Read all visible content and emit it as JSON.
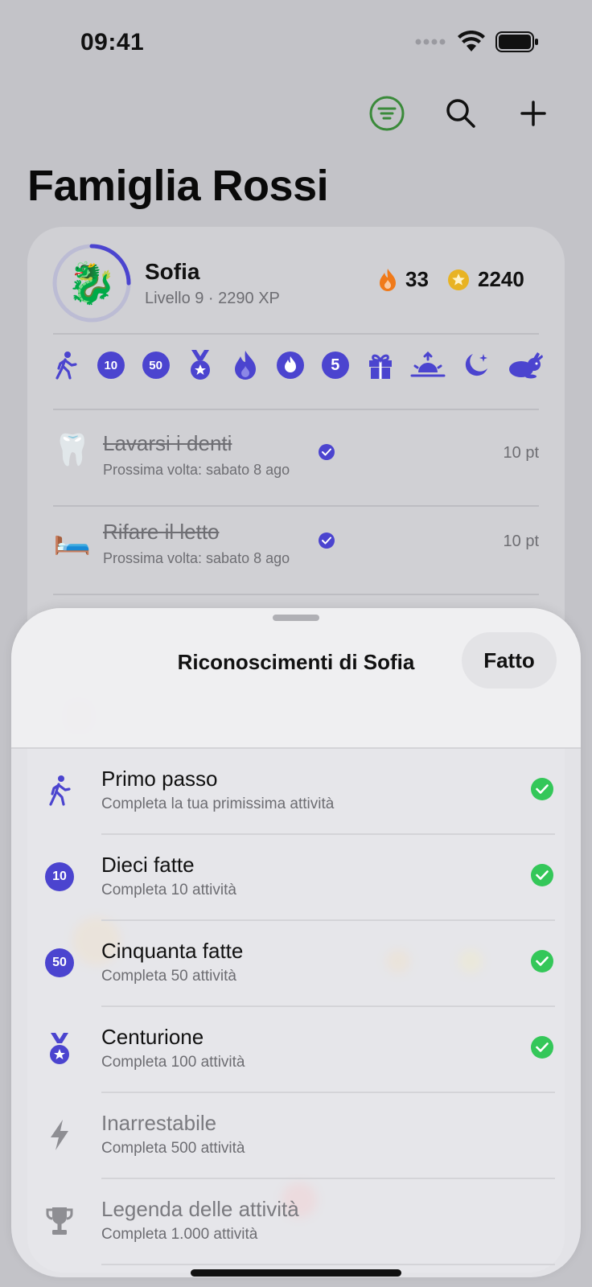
{
  "status_bar": {
    "time": "09:41"
  },
  "header": {
    "title": "Famiglia Rossi"
  },
  "profile": {
    "name": "Sofia",
    "subtitle": "Livello 9 · 2290 XP",
    "avatar": "🐉",
    "level_progress": 0.25,
    "streak": "33",
    "points": "2240"
  },
  "badges": [
    {
      "icon": "walking-icon"
    },
    {
      "label": "10"
    },
    {
      "label": "50"
    },
    {
      "icon": "medal-icon"
    },
    {
      "icon": "flame-icon"
    },
    {
      "icon": "flame-icon"
    },
    {
      "label": "5"
    },
    {
      "icon": "gift-icon"
    },
    {
      "icon": "sunrise-icon"
    },
    {
      "icon": "moon-stars-icon"
    },
    {
      "icon": "rabbit-icon"
    }
  ],
  "tasks": [
    {
      "emoji": "🦷",
      "title": "Lavarsi i denti",
      "subtitle": "Prossima volta: sabato 8 ago",
      "points": "10 pt"
    },
    {
      "emoji": "🛏️",
      "title": "Rifare il letto",
      "subtitle": "Prossima volta: sabato 8 ago",
      "points": "10 pt"
    }
  ],
  "sheet": {
    "title": "Riconoscimenti di Sofia",
    "done_label": "Fatto",
    "achievements": [
      {
        "icon": "walking-icon",
        "title": "Primo passo",
        "description": "Completa la tua primissima attività",
        "earned": true
      },
      {
        "icon": "badge-10-icon",
        "number": "10",
        "title": "Dieci fatte",
        "description": "Completa 10 attività",
        "earned": true
      },
      {
        "icon": "badge-50-icon",
        "number": "50",
        "title": "Cinquanta fatte",
        "description": "Completa 50 attività",
        "earned": true
      },
      {
        "icon": "medal-icon",
        "title": "Centurione",
        "description": "Completa 100 attività",
        "earned": true
      },
      {
        "icon": "bolt-icon",
        "title": "Inarrestabile",
        "description": "Completa 500 attività",
        "earned": false
      },
      {
        "icon": "trophy-icon",
        "title": "Legenda delle attività",
        "description": "Completa 1.000 attività",
        "earned": false
      }
    ]
  },
  "colors": {
    "accent": "#4b44cf",
    "success": "#34c759",
    "streak": "#f07a1a",
    "coin": "#e8b323",
    "filter": "#3a8a3a"
  }
}
